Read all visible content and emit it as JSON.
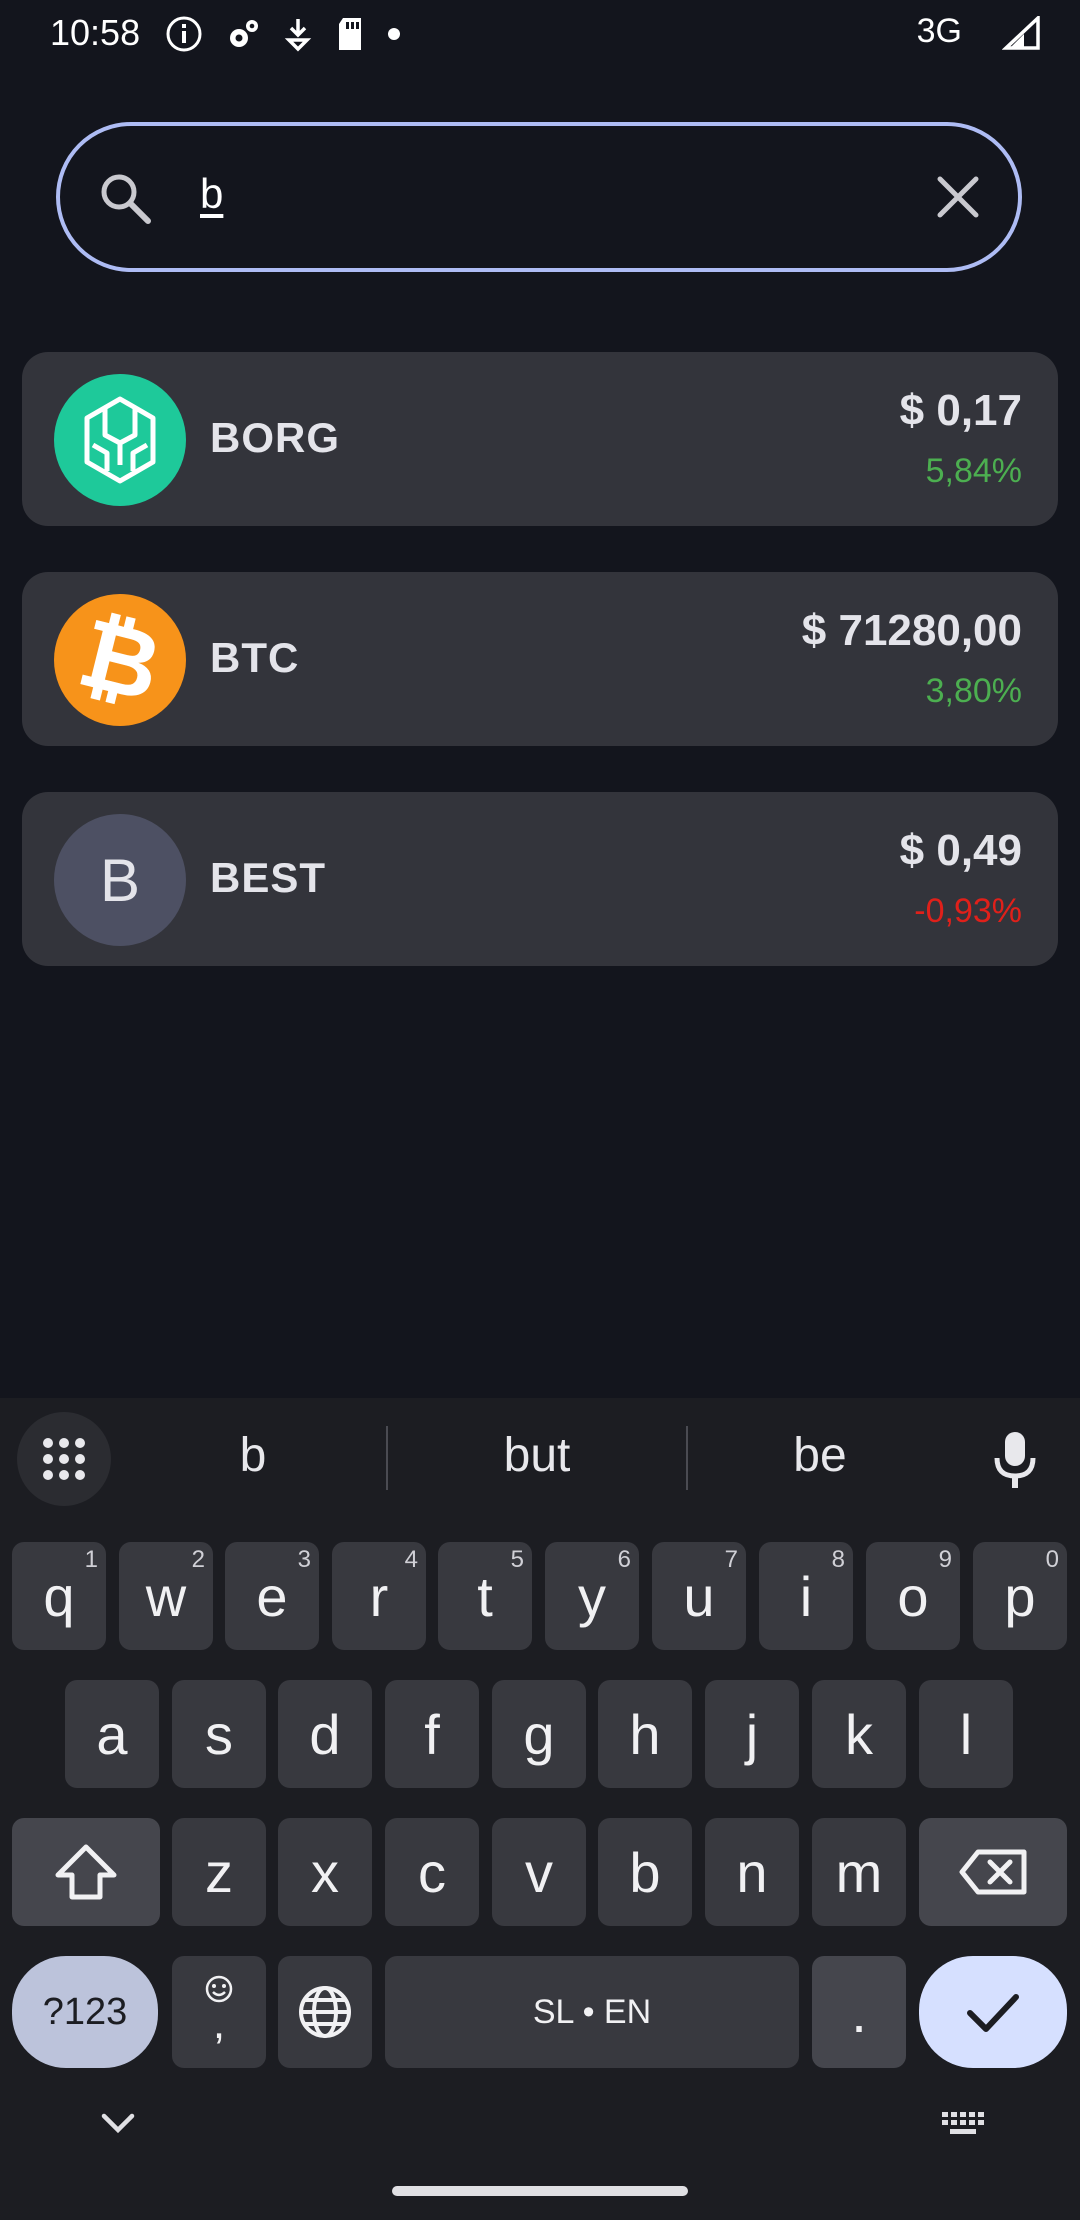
{
  "status_bar": {
    "time": "10:58",
    "network": "3G"
  },
  "search": {
    "query": "b"
  },
  "coins": [
    {
      "symbol": "BORG",
      "price": "$ 0,17",
      "change": "5,84%",
      "change_color": "#4caf50",
      "logo": "borg-logo"
    },
    {
      "symbol": "BTC",
      "price": "$ 71280,00",
      "change": "3,80%",
      "change_color": "#4caf50",
      "logo": "bitcoin-logo"
    },
    {
      "symbol": "BEST",
      "price": "$ 0,49",
      "change": "-0,93%",
      "change_color": "#e0201a",
      "logo": "letter-logo",
      "logo_letter": "B"
    }
  ],
  "keyboard": {
    "suggestions": [
      "b",
      "but",
      "be"
    ],
    "row1": [
      {
        "k": "q",
        "n": "1"
      },
      {
        "k": "w",
        "n": "2"
      },
      {
        "k": "e",
        "n": "3"
      },
      {
        "k": "r",
        "n": "4"
      },
      {
        "k": "t",
        "n": "5"
      },
      {
        "k": "y",
        "n": "6"
      },
      {
        "k": "u",
        "n": "7"
      },
      {
        "k": "i",
        "n": "8"
      },
      {
        "k": "o",
        "n": "9"
      },
      {
        "k": "p",
        "n": "0"
      }
    ],
    "row2": [
      "a",
      "s",
      "d",
      "f",
      "g",
      "h",
      "j",
      "k",
      "l"
    ],
    "row3": [
      "z",
      "x",
      "c",
      "v",
      "b",
      "n",
      "m"
    ],
    "symbols_label": "?123",
    "comma_label": ",",
    "space_label": "SL • EN",
    "period_label": "."
  },
  "colors": {
    "background": "#13151d",
    "card": "#33343b",
    "accent": "#aebcf4",
    "positive": "#4caf50",
    "negative": "#e0201a"
  }
}
